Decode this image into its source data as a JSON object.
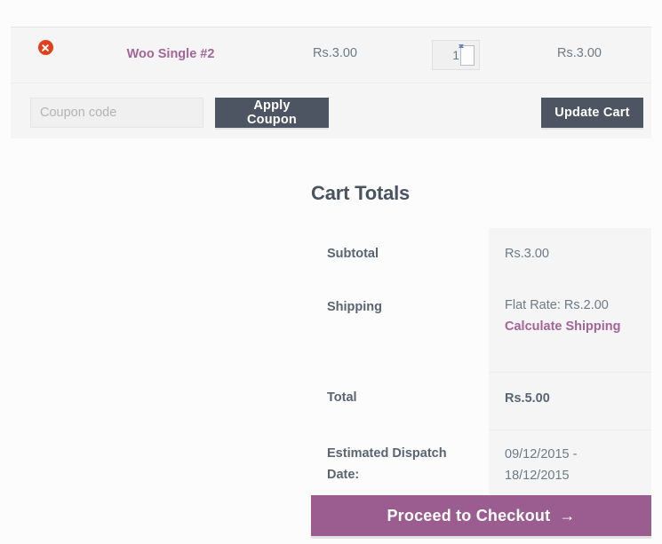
{
  "cart": {
    "item": {
      "remove_icon": "remove-circle-icon",
      "name": "Woo Single #2",
      "price": "Rs.3.00",
      "quantity": "1",
      "line_total": "Rs.3.00"
    },
    "coupon": {
      "placeholder": "Coupon code",
      "value": "",
      "apply_label": "Apply Coupon"
    },
    "update_label": "Update Cart"
  },
  "totals": {
    "heading": "Cart Totals",
    "rows": [
      {
        "label": "Subtotal",
        "value": "Rs.3.00"
      },
      {
        "label": "Shipping",
        "value": "Flat Rate: Rs.2.00",
        "link": "Calculate Shipping"
      },
      {
        "label": "Total",
        "value": "Rs.5.00"
      },
      {
        "label": "Estimated Dispatch Date:",
        "value": "09/12/2015 - 18/12/2015"
      }
    ]
  },
  "checkout": {
    "label": "Proceed to Checkout",
    "arrow_icon": "→"
  },
  "colors": {
    "accent_purple": "#a46497",
    "checkout_purple": "#9b5c8f",
    "dark_button": "#4e5562",
    "remove_red": "#e2401c",
    "panel_gray": "#f5f5f5"
  }
}
